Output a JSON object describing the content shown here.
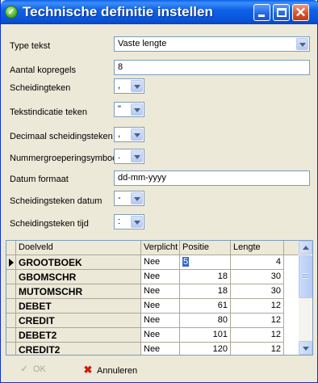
{
  "window": {
    "title": "Technische definitie instellen",
    "title_icon": "check-circle-icon",
    "controls": [
      "minimize-icon",
      "maximize-icon",
      "close-icon"
    ]
  },
  "form": {
    "type_tekst": {
      "label": "Type tekst",
      "value": "Vaste lengte"
    },
    "aantal_kopregels": {
      "label": "Aantal kopregels",
      "value": "8"
    },
    "scheidingsteken": {
      "label": "Scheidingteken",
      "value": ","
    },
    "tekstindicatie": {
      "label": "Tekstindicatie teken",
      "value": "\""
    },
    "decimaal": {
      "label": "Decimaal scheidingsteken",
      "value": ","
    },
    "nummergroepering": {
      "label": "Nummergroeperingsymbool",
      "value": "."
    },
    "datum_formaat": {
      "label": "Datum formaat",
      "value": "dd-mm-yyyy"
    },
    "scheidingsteken_datum": {
      "label": "Scheidingsteken datum",
      "value": "-"
    },
    "scheidingsteken_tijd": {
      "label": "Scheidingsteken tijd",
      "value": ":"
    }
  },
  "grid": {
    "columns": [
      "Doelveld",
      "Verplicht",
      "Positie",
      "Lengte"
    ],
    "rows": [
      {
        "doelveld": "GROOTBOEK",
        "verplicht": "Nee",
        "positie": "5",
        "lengte": "4"
      },
      {
        "doelveld": "GBOMSCHR",
        "verplicht": "Nee",
        "positie": "18",
        "lengte": "30"
      },
      {
        "doelveld": "MUTOMSCHR",
        "verplicht": "Nee",
        "positie": "18",
        "lengte": "30"
      },
      {
        "doelveld": "DEBET",
        "verplicht": "Nee",
        "positie": "61",
        "lengte": "12"
      },
      {
        "doelveld": "CREDIT",
        "verplicht": "Nee",
        "positie": "80",
        "lengte": "12"
      },
      {
        "doelveld": "DEBET2",
        "verplicht": "Nee",
        "positie": "101",
        "lengte": "12"
      },
      {
        "doelveld": "CREDIT2",
        "verplicht": "Nee",
        "positie": "120",
        "lengte": "12"
      }
    ]
  },
  "buttons": {
    "ok": {
      "label": "OK",
      "icon": "check-icon",
      "enabled": false
    },
    "annuleren": {
      "label": "Annuleren",
      "icon": "x-cross-icon"
    }
  },
  "colors": {
    "titlebar": "#0a55de",
    "face": "#ece9d8",
    "selection": "#316ac5",
    "cancel_icon": "#d21a0c"
  }
}
